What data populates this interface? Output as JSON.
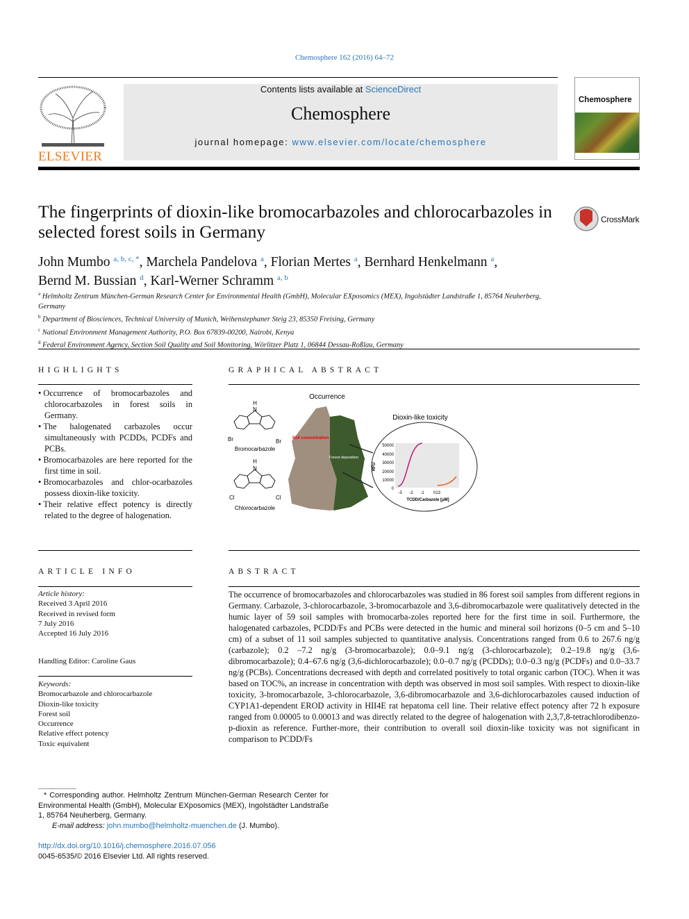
{
  "header": {
    "journal_ref": "Chemosphere 162 (2016) 64–72",
    "contents_prefix": "Contents lists available at ",
    "contents_link": "ScienceDirect",
    "journal_name": "Chemosphere",
    "homepage_prefix": "journal homepage: ",
    "homepage_link": "www.elsevier.com/locate/chemosphere",
    "publisher": "ELSEVIER",
    "cover_title": "Chemosphere",
    "crossmark": "CrossMark"
  },
  "article": {
    "title": "The fingerprints of dioxin-like bromocarbazoles and chlorocarbazoles in selected forest soils in Germany",
    "authors": [
      {
        "name": "John Mumbo",
        "sup": "a, b, c, *"
      },
      {
        "name": "Marchela Pandelova",
        "sup": "a"
      },
      {
        "name": "Florian Mertes",
        "sup": "a"
      },
      {
        "name": "Bernhard Henkelmann",
        "sup": "a"
      },
      {
        "name": "Bernd M. Bussian",
        "sup": "d"
      },
      {
        "name": "Karl-Werner Schramm",
        "sup": "a, b"
      }
    ],
    "affiliations": [
      {
        "key": "a",
        "text": "Helmholtz Zentrum München-German Research Center for Environmental Health (GmbH), Molecular EXposomics (MEX), Ingolstädter Landstraße 1, 85764 Neuherberg, Germany"
      },
      {
        "key": "b",
        "text": "Department of Biosciences, Technical University of Munich, Weihenstephaner Steig 23, 85350 Freising, Germany"
      },
      {
        "key": "c",
        "text": "National Environment Management Authority, P.O. Box 67839-00200, Nairobi, Kenya"
      },
      {
        "key": "d",
        "text": "Federal Environment Agency, Section Soil Quality and Soil Monitoring, Wörlitzer Platz 1, 06844 Dessau-Roßlau, Germany"
      }
    ]
  },
  "highlights": {
    "heading": "HIGHLIGHTS",
    "items": [
      "Occurrence of bromocarbazoles and chlorocarbazoles in forest soils in Germany.",
      "The halogenated carbazoles occur simultaneously with PCDDs, PCDFs and PCBs.",
      "Bromocarbazoles are here reported for the first time in soil.",
      "Bromocarbazoles and chlor-ocarbazoles possess dioxin-like toxicity.",
      "Their relative effect potency is directly related to the degree of halogenation."
    ]
  },
  "graphical_abstract": {
    "heading": "GRAPHICAL ABSTRACT",
    "occurrence": "Occurrence",
    "toxicity": "Dioxin-like toxicity",
    "bromo": "Bromocarbazole",
    "chloro": "Chlorocarbazole",
    "h": "H",
    "n": "N",
    "br": "Br",
    "cl": "Cl",
    "soil": "Soil concentration",
    "forest": "Forest deposition",
    "ylabel": "RFU",
    "xlabel": "TCDD/Carbazole [μM]",
    "yticks": [
      "50000",
      "40000",
      "30000",
      "20000",
      "10000",
      "0"
    ],
    "xticks": [
      "-3",
      "-2",
      "-1",
      "013"
    ]
  },
  "article_info": {
    "heading": "ARTICLE INFO",
    "history_label": "Article history:",
    "history": [
      "Received 3 April 2016",
      "Received in revised form",
      "7 July 2016",
      "Accepted 16 July 2016"
    ],
    "editor": "Handling Editor: Caroline Gaus",
    "keywords_label": "Keywords:",
    "keywords": [
      "Bromocarbazole and chlorocarbazole",
      "Dioxin-like toxicity",
      "Forest soil",
      "Occurrence",
      "Relative effect potency",
      "Toxic equivalent"
    ]
  },
  "abstract": {
    "heading": "ABSTRACT",
    "text": "The occurrence of bromocarbazoles and chlorocarbazoles was studied in 86 forest soil samples from different regions in Germany. Carbazole, 3-chlorocarbazole, 3-bromocarbazole and 3,6-dibromocarbazole were qualitatively detected in the humic layer of 59 soil samples with bromocarba-zoles reported here for the first time in soil. Furthermore, the halogenated carbazoles, PCDD/Fs and PCBs were detected in the humic and mineral soil horizons (0–5 cm and 5–10 cm) of a subset of 11 soil samples subjected to quantitative analysis. Concentrations ranged from 0.6 to 267.6 ng/g (carbazole); 0.2 –7.2 ng/g (3-bromocarbazole); 0.0–9.1 ng/g (3-chlorocarbazole); 0.2–19.8 ng/g (3,6-dibromocarbazole); 0.4–67.6 ng/g (3,6-dichlorocarbazole); 0.0–0.7 ng/g (PCDDs); 0.0–0.3 ng/g (PCDFs) and 0.0–33.7 ng/g (PCBs). Concentrations decreased with depth and correlated positively to total organic carbon (TOC). When it was based on TOC%, an increase in concentration with depth was observed in most soil samples. With respect to dioxin-like toxicity, 3-bromocarbazole, 3-chlorocarbazole, 3,6-dibromocarbazole and 3,6-dichlorocarbazoles caused induction of CYP1A1-dependent EROD activity in HII4E rat hepatoma cell line. Their relative effect potency after 72 h exposure ranged from 0.00005 to 0.00013 and was directly related to the degree of halogenation with 2,3,7,8-tetrachlorodibenzo-p-dioxin as reference. Further-more, their contribution to overall soil dioxin-like toxicity was not significant in comparison to PCDD/Fs"
  },
  "footnote": {
    "corresponding": "* Corresponding author. Helmholtz Zentrum München-German Research Center for Environmental Health (GmbH), Molecular EXposomics (MEX), Ingolstädter Landstraße 1, 85764 Neuherberg, Germany.",
    "email_label": "E-mail address: ",
    "email": "john.mumbo@helmholtz-muenchen.de",
    "email_suffix": " (J. Mumbo).",
    "doi": "http://dx.doi.org/10.1016/j.chemosphere.2016.07.056",
    "copyright": "0045-6535/© 2016 Elsevier Ltd. All rights reserved."
  },
  "colors": {
    "link": "#2a76b6",
    "elsevier_orange": "#f07a1a",
    "header_grey": "#e9e9e9"
  }
}
